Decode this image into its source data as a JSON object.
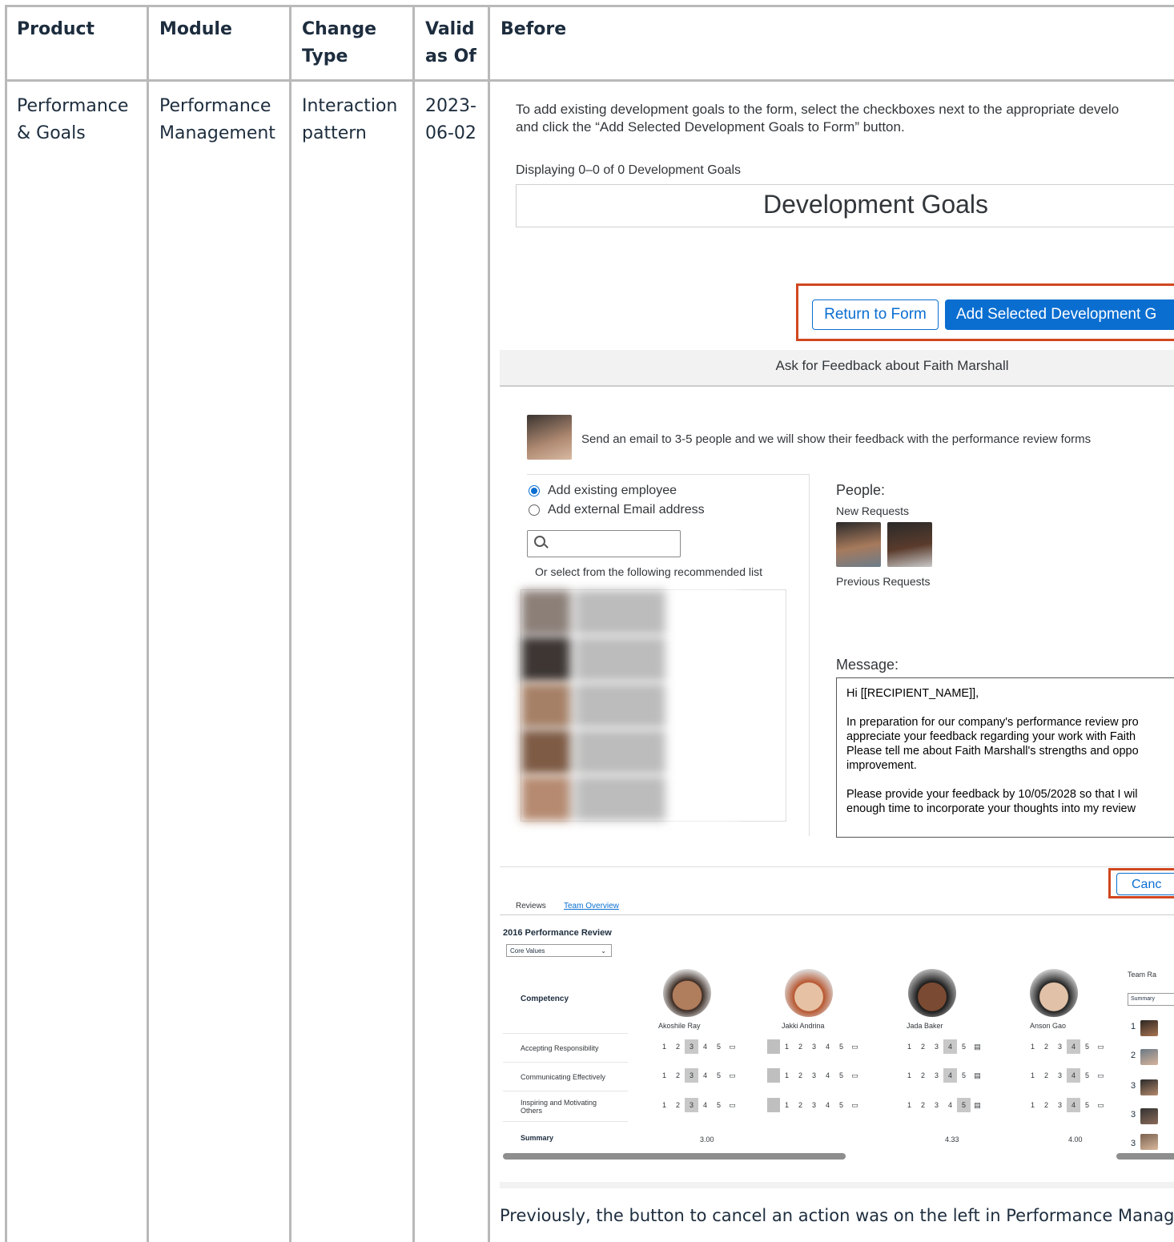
{
  "table": {
    "headers": {
      "product": "Product",
      "module": "Module",
      "change_type": "Change Type",
      "valid_as_of": "Valid as Of",
      "before": "Before"
    },
    "row": {
      "product": "Performance & Goals",
      "module": "Performance Management",
      "change_type": "Interaction pattern",
      "valid_as_of": "2023-06-02"
    }
  },
  "dev_goals": {
    "intro_line1": "To add existing development goals to the form, select the checkboxes next to the appropriate develo",
    "intro_line2": "and click the “Add Selected Development Goals to Form” button.",
    "displaying": "Displaying 0–0 of 0 Development Goals",
    "title": "Development Goals",
    "return_button": "Return to Form",
    "add_button": "Add Selected Development G"
  },
  "feedback": {
    "title": "Ask for Feedback about Faith Marshall",
    "send_text": "Send an email to 3-5 people and we will show their feedback with the performance review forms",
    "radio_existing": "Add existing employee",
    "radio_external": "Add external Email address",
    "recommend_text": "Or select from the following recommended list",
    "people_label": "People:",
    "new_requests": "New Requests",
    "previous_requests": "Previous Requests",
    "message_label": "Message:",
    "message": {
      "l1": "Hi [[RECIPIENT_NAME]],",
      "l2": "In preparation for our company's performance review pro",
      "l3": "appreciate your feedback regarding your work with Faith",
      "l4": "Please tell me about Faith Marshall's strengths and oppo",
      "l5": "improvement.",
      "l6": "Please provide your feedback by 10/05/2028 so that I wil",
      "l7": "enough time to incorporate your thoughts into my review"
    },
    "cancel_button": "Canc"
  },
  "team_overview": {
    "tab_reviews": "Reviews",
    "tab_team": "Team Overview",
    "review_title": "2016 Performance Review",
    "select_value": "Core Values",
    "competency": "Competency",
    "people": [
      "Akoshile Ray",
      "Jakki Andrina",
      "Jada Baker",
      "Anson Gao"
    ],
    "rows": [
      "Accepting Responsibility",
      "Communicating Effectively",
      "Inspiring and Motivating Others"
    ],
    "summary_label": "Summary",
    "summaries": [
      "3.00",
      "",
      "4.33",
      "4.00"
    ],
    "team_rating": "Team Ra",
    "summary_select": "Summary",
    "ranks": [
      "1",
      "2",
      "3",
      "3",
      "3"
    ]
  },
  "footer_text": "Previously, the button to cancel an action was on the left in Performance Manager"
}
